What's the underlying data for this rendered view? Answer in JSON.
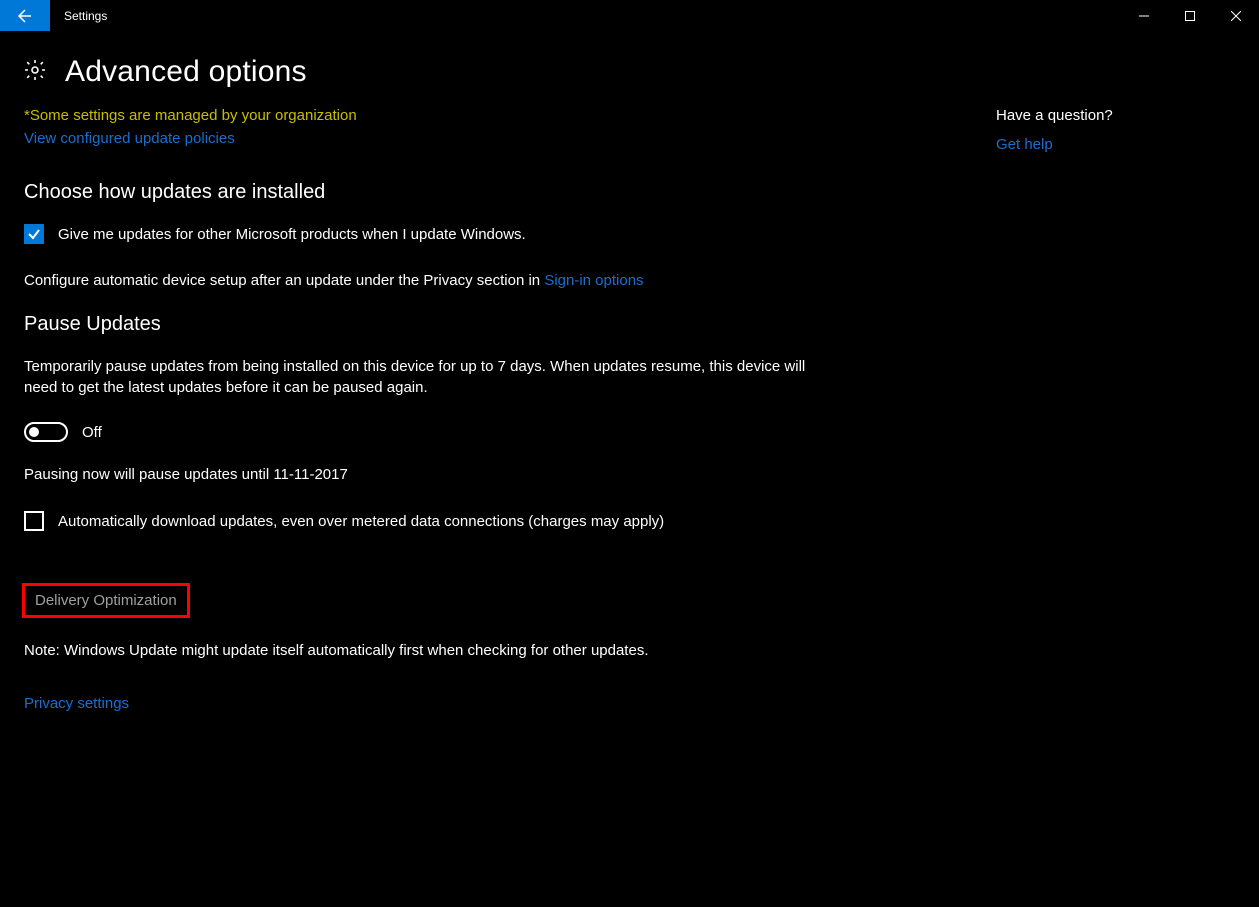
{
  "window": {
    "title": "Settings"
  },
  "header": {
    "title": "Advanced options"
  },
  "notices": {
    "org_managed": "*Some settings are managed by your organization",
    "view_policies": "View configured update policies"
  },
  "install": {
    "heading": "Choose how updates are installed",
    "cb_other_products": "Give me updates for other Microsoft products when I update Windows.",
    "configure_prefix": "Configure automatic device setup after an update under the Privacy section in ",
    "configure_link": "Sign-in options"
  },
  "pause": {
    "heading": "Pause Updates",
    "desc": "Temporarily pause updates from being installed on this device for up to 7 days. When updates resume, this device will need to get the latest updates before it can be paused again.",
    "toggle_label": "Off",
    "pause_until": "Pausing now will pause updates until 11-11-2017",
    "cb_metered": "Automatically download updates, even over metered data connections (charges may apply)"
  },
  "footer": {
    "delivery_opt": "Delivery Optimization",
    "note": "Note: Windows Update might update itself automatically first when checking for other updates.",
    "privacy": "Privacy settings"
  },
  "side": {
    "heading": "Have a question?",
    "help": "Get help"
  }
}
